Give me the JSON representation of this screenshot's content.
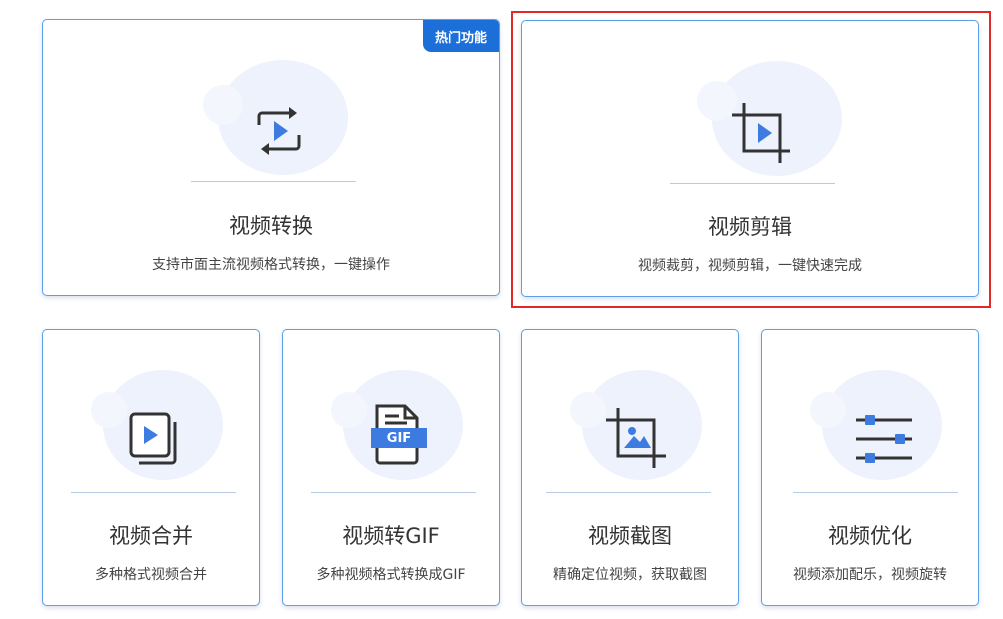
{
  "cards": {
    "convert": {
      "title": "视频转换",
      "desc": "支持市面主流视频格式转换，一键操作",
      "badge": "热门功能"
    },
    "edit": {
      "title": "视频剪辑",
      "desc": "视频裁剪，视频剪辑，一键快速完成"
    },
    "merge": {
      "title": "视频合并",
      "desc": "多种格式视频合并"
    },
    "gif": {
      "title": "视频转GIF",
      "desc": "多种视频格式转换成GIF",
      "icon_text": "GIF"
    },
    "screenshot": {
      "title": "视频截图",
      "desc": "精确定位视频，获取截图"
    },
    "optimize": {
      "title": "视频优化",
      "desc": "视频添加配乐，视频旋转"
    }
  },
  "colors": {
    "accent": "#1c6fd8",
    "border": "#5d9ee6",
    "selection": "#e02a2a",
    "icon_blue": "#3d7be0",
    "icon_dark": "#333333"
  },
  "icons": {
    "convert": "convert-play-icon",
    "edit": "crop-play-icon",
    "merge": "stacked-play-icon",
    "gif": "gif-file-icon",
    "screenshot": "crop-image-icon",
    "optimize": "sliders-icon"
  }
}
